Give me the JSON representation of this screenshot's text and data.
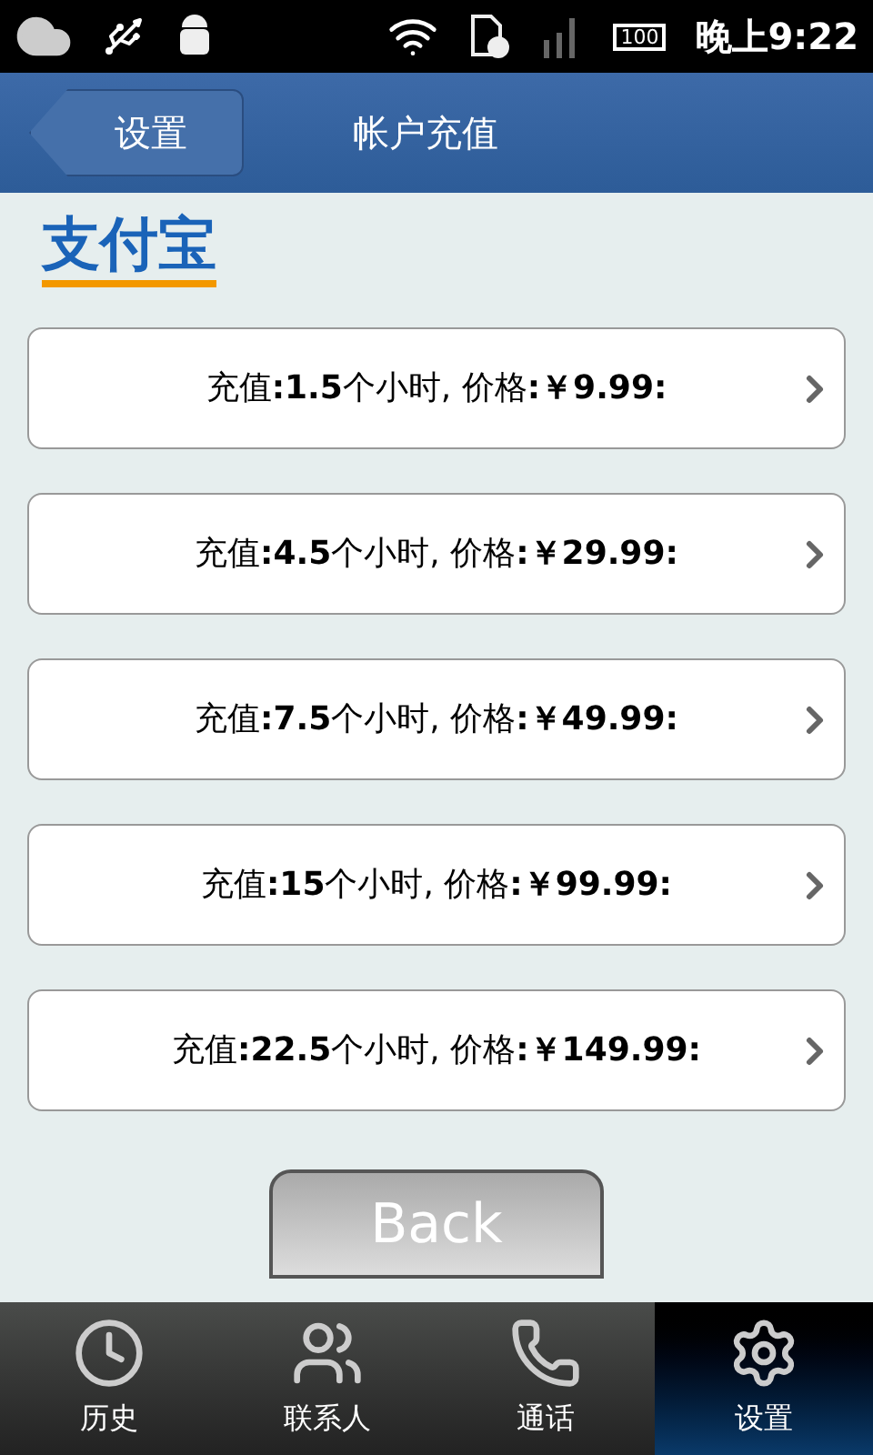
{
  "status_bar": {
    "time": "晚上9:22",
    "battery": "100"
  },
  "header": {
    "back": "设置",
    "title": "帐户充值"
  },
  "logo": "支付宝",
  "options": [
    {
      "label": "充值**:1.5**个小时, 价格**:￥9.99:**"
    },
    {
      "label": "充值**:4.5**个小时, 价格**:￥29.99:**"
    },
    {
      "label": "充值**:7.5**个小时, 价格**:￥49.99:**"
    },
    {
      "label": "充值**:15**个小时, 价格**:￥99.99:**"
    },
    {
      "label": "充值**:22.5**个小时, 价格**:￥149.99:**"
    }
  ],
  "back_button": "Back",
  "tabs": [
    {
      "label": "历史",
      "kind": "history",
      "selected": false
    },
    {
      "label": "联系人",
      "kind": "contacts",
      "selected": false
    },
    {
      "label": "通话",
      "kind": "calls",
      "selected": false
    },
    {
      "label": "设置",
      "kind": "settings",
      "selected": true
    }
  ]
}
